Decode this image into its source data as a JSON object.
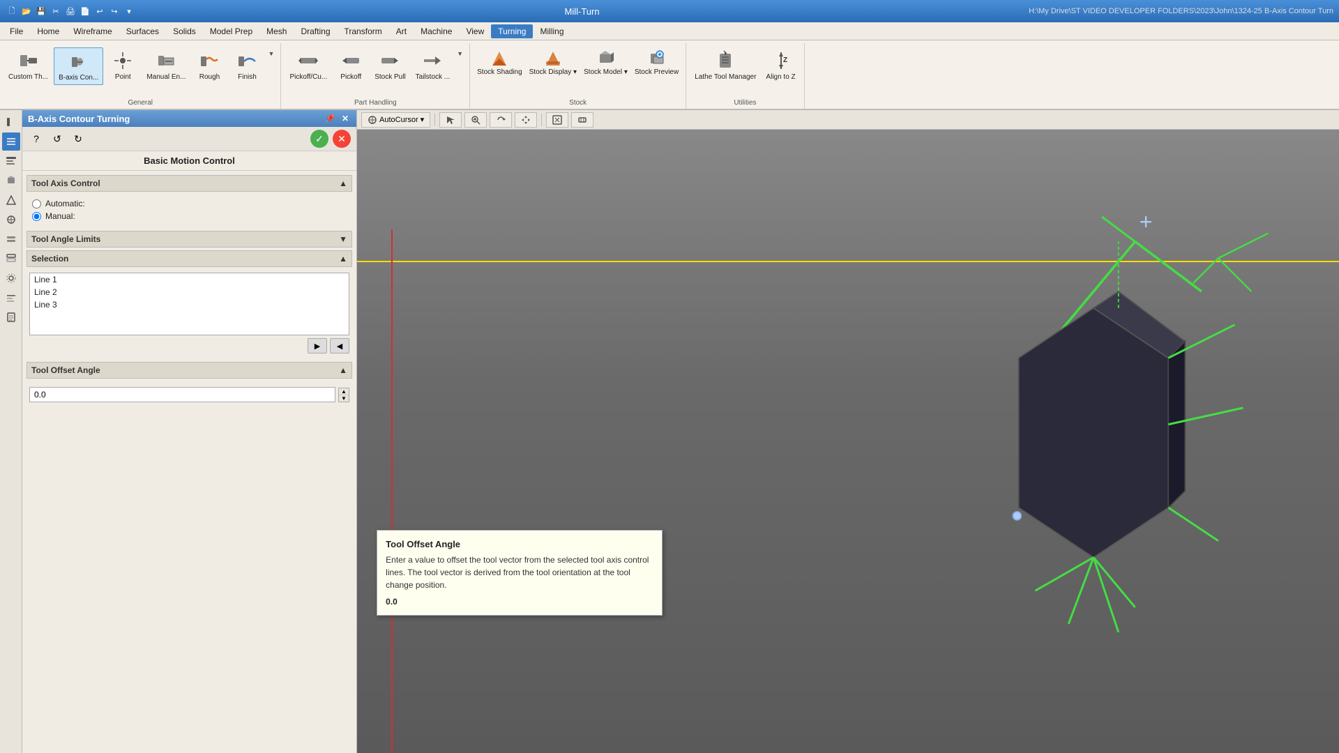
{
  "titlebar": {
    "app_name": "Mill-Turn",
    "file_path": "H:\\My Drive\\ST VIDEO DEVELOPER FOLDERS\\2023\\John\\1324-25 B-Axis Contour Turn",
    "min_label": "─",
    "max_label": "□",
    "close_label": "✕"
  },
  "quickaccess": {
    "icons": [
      "🗋",
      "🖫",
      "💾",
      "✂",
      "🖨",
      "🖹",
      "↩",
      "↪",
      "▾"
    ]
  },
  "menu": {
    "items": [
      "File",
      "Home",
      "Wireframe",
      "Surfaces",
      "Solids",
      "Model Prep",
      "Mesh",
      "Drafting",
      "Transform",
      "Art",
      "Machine",
      "View",
      "Turning",
      "Milling"
    ],
    "active": "Turning"
  },
  "ribbon": {
    "groups": [
      {
        "label": "General",
        "buttons": [
          {
            "icon": "⚙",
            "label": "Custom Th..."
          },
          {
            "icon": "↻",
            "label": "B-axis Con...",
            "active": true
          },
          {
            "icon": "•",
            "label": "Point"
          },
          {
            "icon": "≡",
            "label": "Manual En..."
          },
          {
            "icon": "〜",
            "label": "Rough"
          },
          {
            "icon": "⌒",
            "label": "Finish"
          },
          {
            "icon": "▾",
            "label": ""
          }
        ]
      },
      {
        "label": "Part Handling",
        "buttons": [
          {
            "icon": "⊢⊣",
            "label": "Pickoff/Cu..."
          },
          {
            "icon": "⊢",
            "label": "Pickoff"
          },
          {
            "icon": "⊣",
            "label": "Stock Pull"
          },
          {
            "icon": "⊥",
            "label": "Tailstock ..."
          },
          {
            "icon": "▾",
            "label": ""
          }
        ]
      },
      {
        "label": "Stock",
        "buttons": [
          {
            "icon": "▨",
            "label": "Stock Shading"
          },
          {
            "icon": "▤",
            "label": "Stock Display▾"
          },
          {
            "icon": "◧",
            "label": "Stock Model▾"
          },
          {
            "icon": "◫",
            "label": "Stock Preview"
          }
        ]
      },
      {
        "label": "Utilities",
        "buttons": [
          {
            "icon": "⊕",
            "label": "Lathe Tool Manager"
          },
          {
            "icon": "↕",
            "label": "Align to Z"
          }
        ]
      }
    ]
  },
  "panel": {
    "title": "B-Axis Contour Turning",
    "subtitle": "Basic Motion Control",
    "toolbar_icons": [
      "?",
      "↺",
      "↻"
    ],
    "ok_label": "✓",
    "cancel_label": "✕",
    "sections": [
      {
        "name": "Tool Axis Control",
        "expanded": true,
        "radio_options": [
          {
            "label": "Automatic:",
            "checked": false
          },
          {
            "label": "Manual:",
            "checked": true
          }
        ]
      },
      {
        "name": "Tool Angle Limits",
        "expanded": false
      },
      {
        "name": "Selection",
        "expanded": true,
        "list_items": [
          {
            "label": "Line 1",
            "selected": false
          },
          {
            "label": "Line 2",
            "selected": false
          },
          {
            "label": "Line 3",
            "selected": false
          }
        ],
        "btn_add": "▶",
        "btn_remove": "◀"
      },
      {
        "name": "Tool Offset Angle",
        "expanded": true,
        "value": "0.0"
      }
    ]
  },
  "viewport": {
    "toolbar": {
      "autocursor_label": "AutoCursor"
    }
  },
  "tooltip": {
    "title": "Tool Offset Angle",
    "body": "Enter a value to offset the tool vector from the selected tool axis control lines. The tool vector is derived from the tool orientation at the tool change position.",
    "value": "0.0"
  },
  "leftbar": {
    "icons": [
      "┤",
      "≡",
      "▤",
      "⊕",
      "⊿",
      "≈",
      "⊞",
      "⊟",
      "◈",
      "☰",
      "☷"
    ]
  }
}
